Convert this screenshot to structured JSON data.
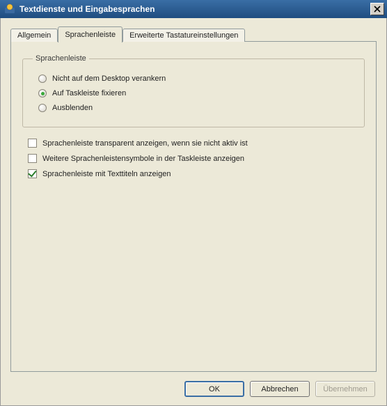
{
  "window": {
    "title": "Textdienste und Eingabesprachen"
  },
  "tabs": {
    "general": "Allgemein",
    "languagebar": "Sprachenleiste",
    "advanced": "Erweiterte Tastatureinstellungen",
    "active": "languagebar"
  },
  "group": {
    "legend": "Sprachenleiste",
    "radios": {
      "notDocked": "Nicht auf dem Desktop verankern",
      "dockTaskbar": "Auf Taskleiste fixieren",
      "hide": "Ausblenden",
      "selected": "dockTaskbar"
    }
  },
  "checks": {
    "transparent": {
      "label": "Sprachenleiste transparent anzeigen, wenn sie nicht aktiv ist",
      "checked": false
    },
    "extraIcons": {
      "label": "Weitere Sprachenleistensymbole in der Taskleiste anzeigen",
      "checked": false
    },
    "textLabels": {
      "label": "Sprachenleiste mit Texttiteln anzeigen",
      "checked": true
    }
  },
  "buttons": {
    "ok": "OK",
    "cancel": "Abbrechen",
    "apply": "Übernehmen"
  }
}
